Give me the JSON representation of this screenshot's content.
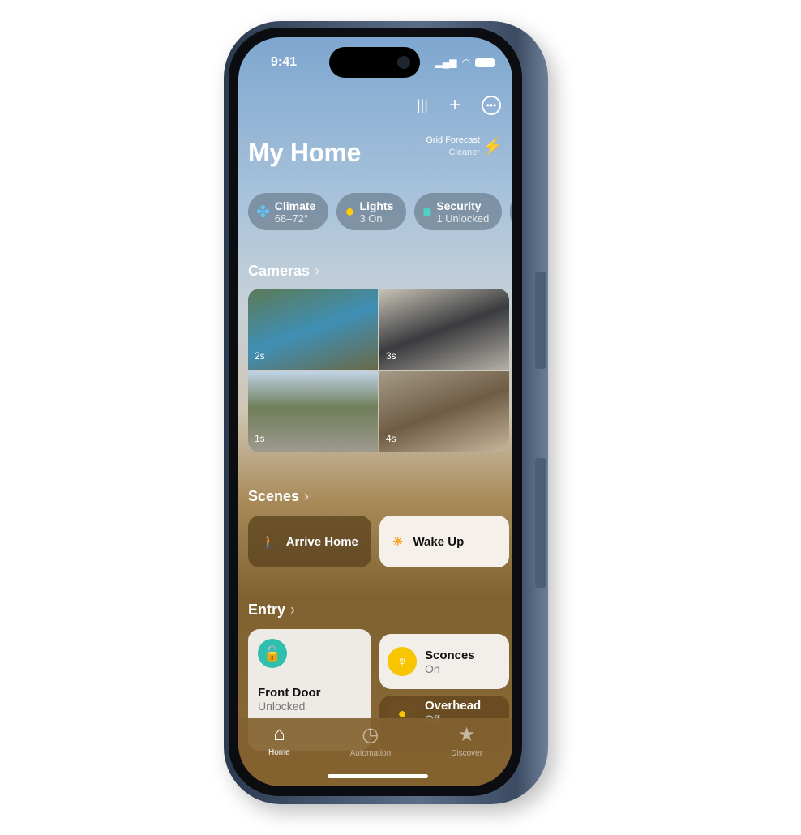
{
  "status": {
    "time": "9:41"
  },
  "header": {
    "title": "My Home",
    "grid_forecast": "Grid Forecast",
    "grid_status": "Cleaner"
  },
  "chips": [
    {
      "label": "Climate",
      "value": "68–72°",
      "icon": "fan-icon",
      "color": "#5ac8fa"
    },
    {
      "label": "Lights",
      "value": "3 On",
      "icon": "lightbulb-icon",
      "color": "#ffcc00"
    },
    {
      "label": "Security",
      "value": "1 Unlocked",
      "icon": "lock-icon",
      "color": "#4fd1c5"
    }
  ],
  "cameras": {
    "title": "Cameras",
    "feeds": [
      {
        "age": "2s"
      },
      {
        "age": "3s"
      },
      {
        "age": "1s"
      },
      {
        "age": "4s"
      }
    ]
  },
  "scenes": {
    "title": "Scenes",
    "items": [
      {
        "label": "Arrive Home"
      },
      {
        "label": "Wake Up"
      }
    ]
  },
  "entry": {
    "title": "Entry",
    "accessories": [
      {
        "name": "Front Door",
        "state": "Unlocked"
      },
      {
        "name": "Sconces",
        "state": "On"
      },
      {
        "name": "Overhead",
        "state": "Off"
      }
    ]
  },
  "tabs": [
    {
      "label": "Home"
    },
    {
      "label": "Automation"
    },
    {
      "label": "Discover"
    }
  ]
}
